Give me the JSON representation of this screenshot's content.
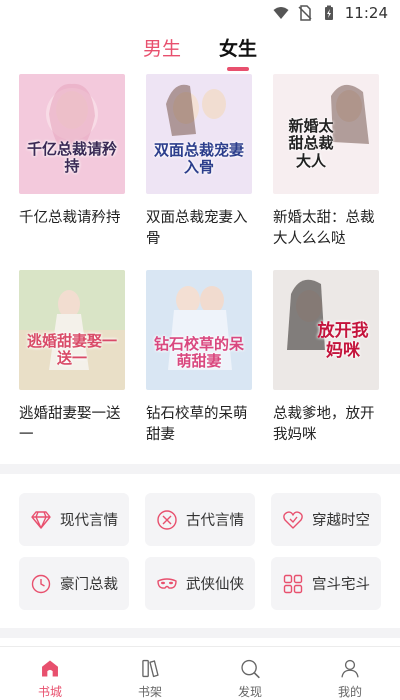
{
  "status_bar": {
    "time": "11:24",
    "icons": [
      "wifi-icon",
      "no-sim-icon",
      "battery-charging-icon"
    ]
  },
  "tabs": [
    {
      "label": "男生",
      "active": false
    },
    {
      "label": "女生",
      "active": true
    }
  ],
  "books": [
    {
      "title": "千亿总裁请矜持",
      "cover_text": "千亿总裁请矜持",
      "cover_color": "#f3c9dc"
    },
    {
      "title": "双面总裁宠妻入骨",
      "cover_text": "双面总裁宠妻入骨",
      "cover_color": "#eee4f4"
    },
    {
      "title": "新婚太甜：总裁大人么么哒",
      "cover_text": "新婚太甜总裁大人",
      "cover_color": "#f7eef0"
    },
    {
      "title": "逃婚甜妻娶一送一",
      "cover_text": "逃婚甜妻娶一送一",
      "cover_color": "#e9dfc7"
    },
    {
      "title": "钻石校草的呆萌甜妻",
      "cover_text": "钻石校草的呆萌甜妻",
      "cover_color": "#d9e6f3"
    },
    {
      "title": "总裁爹地，放开我妈咪",
      "cover_text": "放开我妈咪",
      "cover_color": "#ece8e6"
    }
  ],
  "categories": [
    {
      "label": "现代言情",
      "icon": "diamond-icon"
    },
    {
      "label": "古代言情",
      "icon": "ancient-coin-icon"
    },
    {
      "label": "穿越时空",
      "icon": "heart-icon"
    },
    {
      "label": "豪门总裁",
      "icon": "clock-icon"
    },
    {
      "label": "武侠仙侠",
      "icon": "mask-icon"
    },
    {
      "label": "宫斗宅斗",
      "icon": "grid-icon"
    }
  ],
  "nav": [
    {
      "label": "书城",
      "icon": "home-icon",
      "active": true
    },
    {
      "label": "书架",
      "icon": "bookshelf-icon",
      "active": false
    },
    {
      "label": "发现",
      "icon": "discover-icon",
      "active": false
    },
    {
      "label": "我的",
      "icon": "profile-icon",
      "active": false
    }
  ],
  "colors": {
    "accent": "#e8506e",
    "category_bg": "#f4f4f6",
    "band": "#f3f3f5"
  }
}
